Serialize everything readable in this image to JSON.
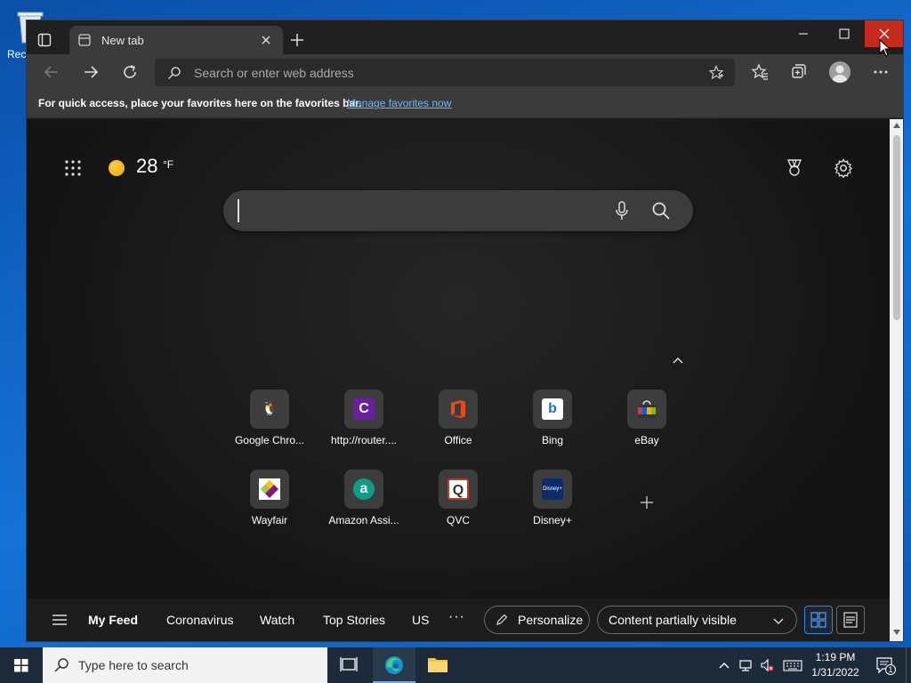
{
  "desktop": {
    "recycle_bin_label": "Rec"
  },
  "browser": {
    "tab_title": "New tab",
    "address_placeholder": "Search or enter web address",
    "favorites_bar": {
      "message": "For quick access, place your favorites here on the favorites bar.",
      "link": "Manage favorites now"
    }
  },
  "newtab": {
    "weather": {
      "temp": "28",
      "unit": "°F"
    },
    "search_placeholder": "",
    "tiles_row1": [
      {
        "label": "Google Chro...",
        "logo": "🐧",
        "color": "#4a4a4a"
      },
      {
        "label": "http://router....",
        "logo": "C",
        "color": "#6b1fa0"
      },
      {
        "label": "Office",
        "logo": "",
        "color": "#d83b01"
      },
      {
        "label": "Bing",
        "logo": "b",
        "color": "#ffffff"
      },
      {
        "label": "eBay",
        "logo": "",
        "color": "#e53238"
      }
    ],
    "tiles_row2": [
      {
        "label": "Wayfair",
        "logo": "",
        "color": "#7f187f"
      },
      {
        "label": "Amazon Assi...",
        "logo": "a",
        "color": "#0f9d8a"
      },
      {
        "label": "QVC",
        "logo": "Q",
        "color": "#ffffff"
      },
      {
        "label": "Disney+",
        "logo": "Disney+",
        "color": "#0c2a6e"
      }
    ],
    "feed": {
      "tabs": [
        "My Feed",
        "Coronavirus",
        "Watch",
        "Top Stories",
        "US"
      ],
      "more": "···",
      "personalize": "Personalize",
      "content_visibility": "Content partially visible"
    }
  },
  "taskbar": {
    "search_placeholder": "Type here to search",
    "time": "1:19 PM",
    "date": "1/31/2022",
    "notification_count": "1"
  }
}
